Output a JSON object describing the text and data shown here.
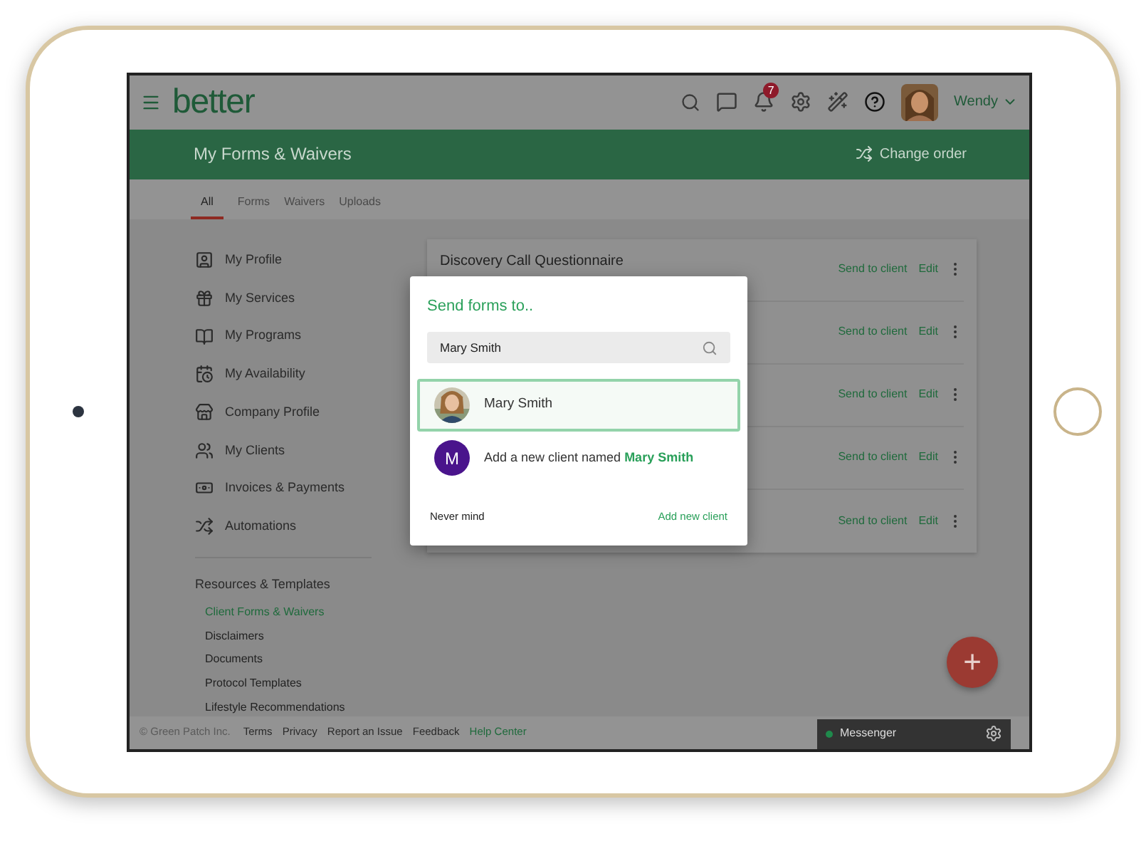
{
  "topbar": {
    "logo": "better",
    "notifications": "7",
    "user": "Wendy"
  },
  "header": {
    "title": "My Forms & Waivers",
    "action": "Change order"
  },
  "tabs": [
    {
      "label": "All",
      "selected": true
    },
    {
      "label": "Forms",
      "selected": false
    },
    {
      "label": "Waivers",
      "selected": false
    },
    {
      "label": "Uploads",
      "selected": false
    }
  ],
  "sidebar": {
    "items": [
      {
        "label": "My Profile"
      },
      {
        "label": "My Services"
      },
      {
        "label": "My Programs"
      },
      {
        "label": "My Availability"
      },
      {
        "label": "Company Profile"
      },
      {
        "label": "My Clients"
      },
      {
        "label": "Invoices & Payments"
      },
      {
        "label": "Automations"
      }
    ],
    "resources": {
      "heading": "Resources & Templates",
      "links": [
        {
          "label": "Client Forms & Waivers",
          "selected": true
        },
        {
          "label": "Disclaimers",
          "selected": false
        },
        {
          "label": "Documents",
          "selected": false
        },
        {
          "label": "Protocol Templates",
          "selected": false
        },
        {
          "label": "Lifestyle Recommendations",
          "selected": false
        }
      ]
    }
  },
  "forms": [
    {
      "title": "Discovery Call Questionnaire",
      "send": "Send to client",
      "edit": "Edit"
    },
    {
      "send": "Send to client",
      "edit": "Edit"
    },
    {
      "send": "Send to client",
      "edit": "Edit"
    },
    {
      "send": "Send to client",
      "edit": "Edit"
    },
    {
      "send": "Send to client",
      "edit": "Edit"
    }
  ],
  "modal": {
    "title": "Send forms to..",
    "search": {
      "value": "Mary Smith"
    },
    "results": [
      {
        "kind": "client",
        "name": "Mary Smith",
        "selected": true
      },
      {
        "kind": "new",
        "initial": "M",
        "text": "Add a new client named **Mary Smith**",
        "selected": false
      }
    ],
    "cancel": "Never mind",
    "confirm": "Add new client"
  },
  "fab": {
    "label": "+"
  },
  "footer": {
    "copyright": "© Green Patch Inc.",
    "links": [
      {
        "label": "Terms",
        "kind": "link"
      },
      {
        "label": "Privacy",
        "kind": "link"
      },
      {
        "label": "Report an Issue",
        "kind": "link"
      },
      {
        "label": "Feedback",
        "kind": "link"
      },
      {
        "label": "Help Center",
        "kind": "help"
      }
    ]
  },
  "messenger": {
    "label": "Messenger",
    "online": true
  }
}
